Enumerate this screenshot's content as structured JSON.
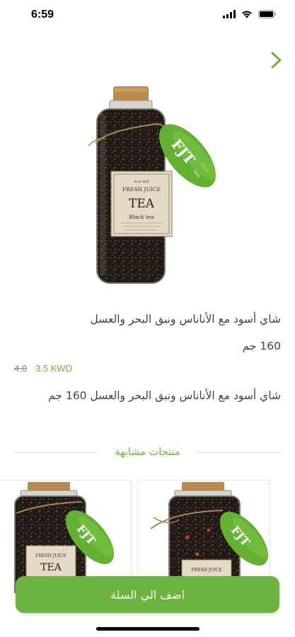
{
  "status_bar": {
    "time": "6:59"
  },
  "product": {
    "name": "شاي أسود مع الأناناس ونبق البحر والعسل",
    "weight": "160 جم",
    "old_price": "4.0",
    "price": "3.5 KWD",
    "description": "شاي أسود مع الأناناس ونبق البحر والعسل 160 جم",
    "label": {
      "small_brand": "Sour Bulf",
      "brand": "FRESH JUICE",
      "title": "TEA",
      "subtitle": "Black tea"
    },
    "tag": {
      "main": "FJT",
      "side": "Fresh",
      "bottom": "time"
    }
  },
  "similar": {
    "title": "منتجات مشابهة"
  },
  "cart": {
    "button_label": "اضف الي السلة"
  },
  "colors": {
    "accent": "#6db33f",
    "cork": "#b98a4e"
  },
  "icons": {
    "next": "chevron-right-icon",
    "signal": "signal-icon",
    "wifi": "wifi-icon",
    "battery": "battery-icon"
  }
}
